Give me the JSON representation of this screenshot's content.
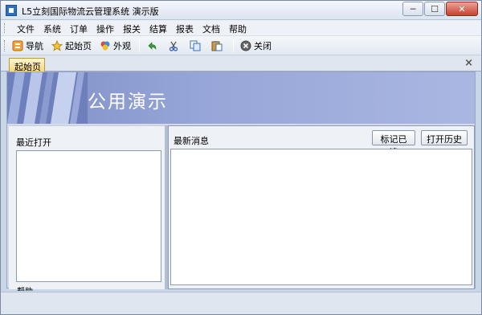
{
  "window": {
    "title": "L5立刻国际物流云管理系统 演示版",
    "controls": [
      "─",
      "☐",
      "✕"
    ]
  },
  "menu": {
    "items": [
      "文件",
      "系统",
      "订单",
      "操作",
      "报关",
      "结算",
      "报表",
      "文档",
      "帮助"
    ]
  },
  "toolbar": {
    "nav_label": "导航",
    "home_label": "起始页",
    "appearance_label": "外观",
    "close_label": "关闭"
  },
  "tabs": {
    "active": "起始页",
    "close_glyph": "×"
  },
  "banner": {
    "title": "公用演示"
  },
  "left_panel": {
    "title": "最近打开",
    "help_label": "帮助"
  },
  "right_panel": {
    "title": "最新消息",
    "mark_read_label": "标记已读",
    "history_label": "打开历史"
  }
}
